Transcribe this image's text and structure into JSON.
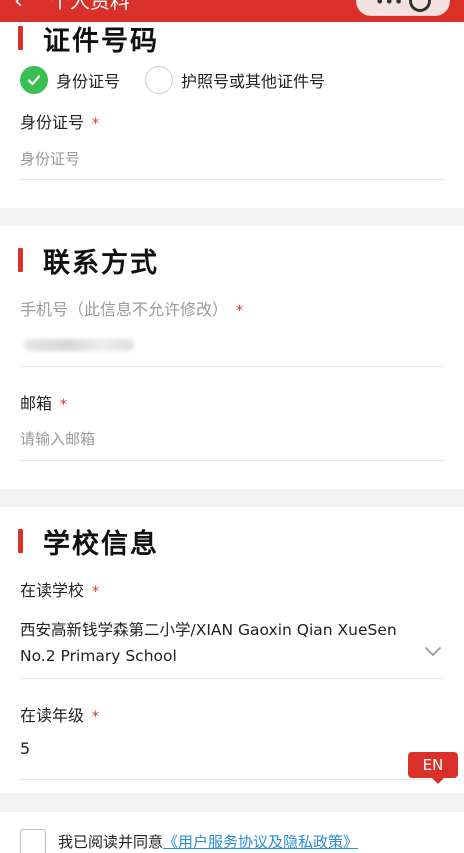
{
  "header": {
    "back_icon": "chevron-left-icon",
    "title": "个人资料",
    "capsule_more": "•••",
    "capsule_close_icon": "target-icon"
  },
  "id_section": {
    "title": "证件号码",
    "options": [
      {
        "label": "身份证号",
        "selected": true
      },
      {
        "label": "护照号或其他证件号",
        "selected": false
      }
    ],
    "field_label": "身份证号",
    "required_mark": "*",
    "placeholder": "身份证号"
  },
  "contact_section": {
    "title": "联系方式",
    "phone_label": "手机号（此信息不允许修改）",
    "phone_required": "*",
    "email_label": "邮箱",
    "email_required": "*",
    "email_placeholder": "请输入邮箱"
  },
  "school_section": {
    "title": "学校信息",
    "school_label": "在读学校",
    "school_required": "*",
    "school_value": "西安高新钱学森第二小学/XIAN Gaoxin Qian XueSen No.2 Primary School",
    "grade_label": "在读年级",
    "grade_required": "*",
    "grade_value": "5"
  },
  "lang_button": "EN",
  "agreement": {
    "text": "我已阅读并同意",
    "link": "《用户服务协议及隐私政策》"
  },
  "colors": {
    "accent": "#d9312a",
    "check": "#3bbf52",
    "link": "#2a8cd8"
  }
}
